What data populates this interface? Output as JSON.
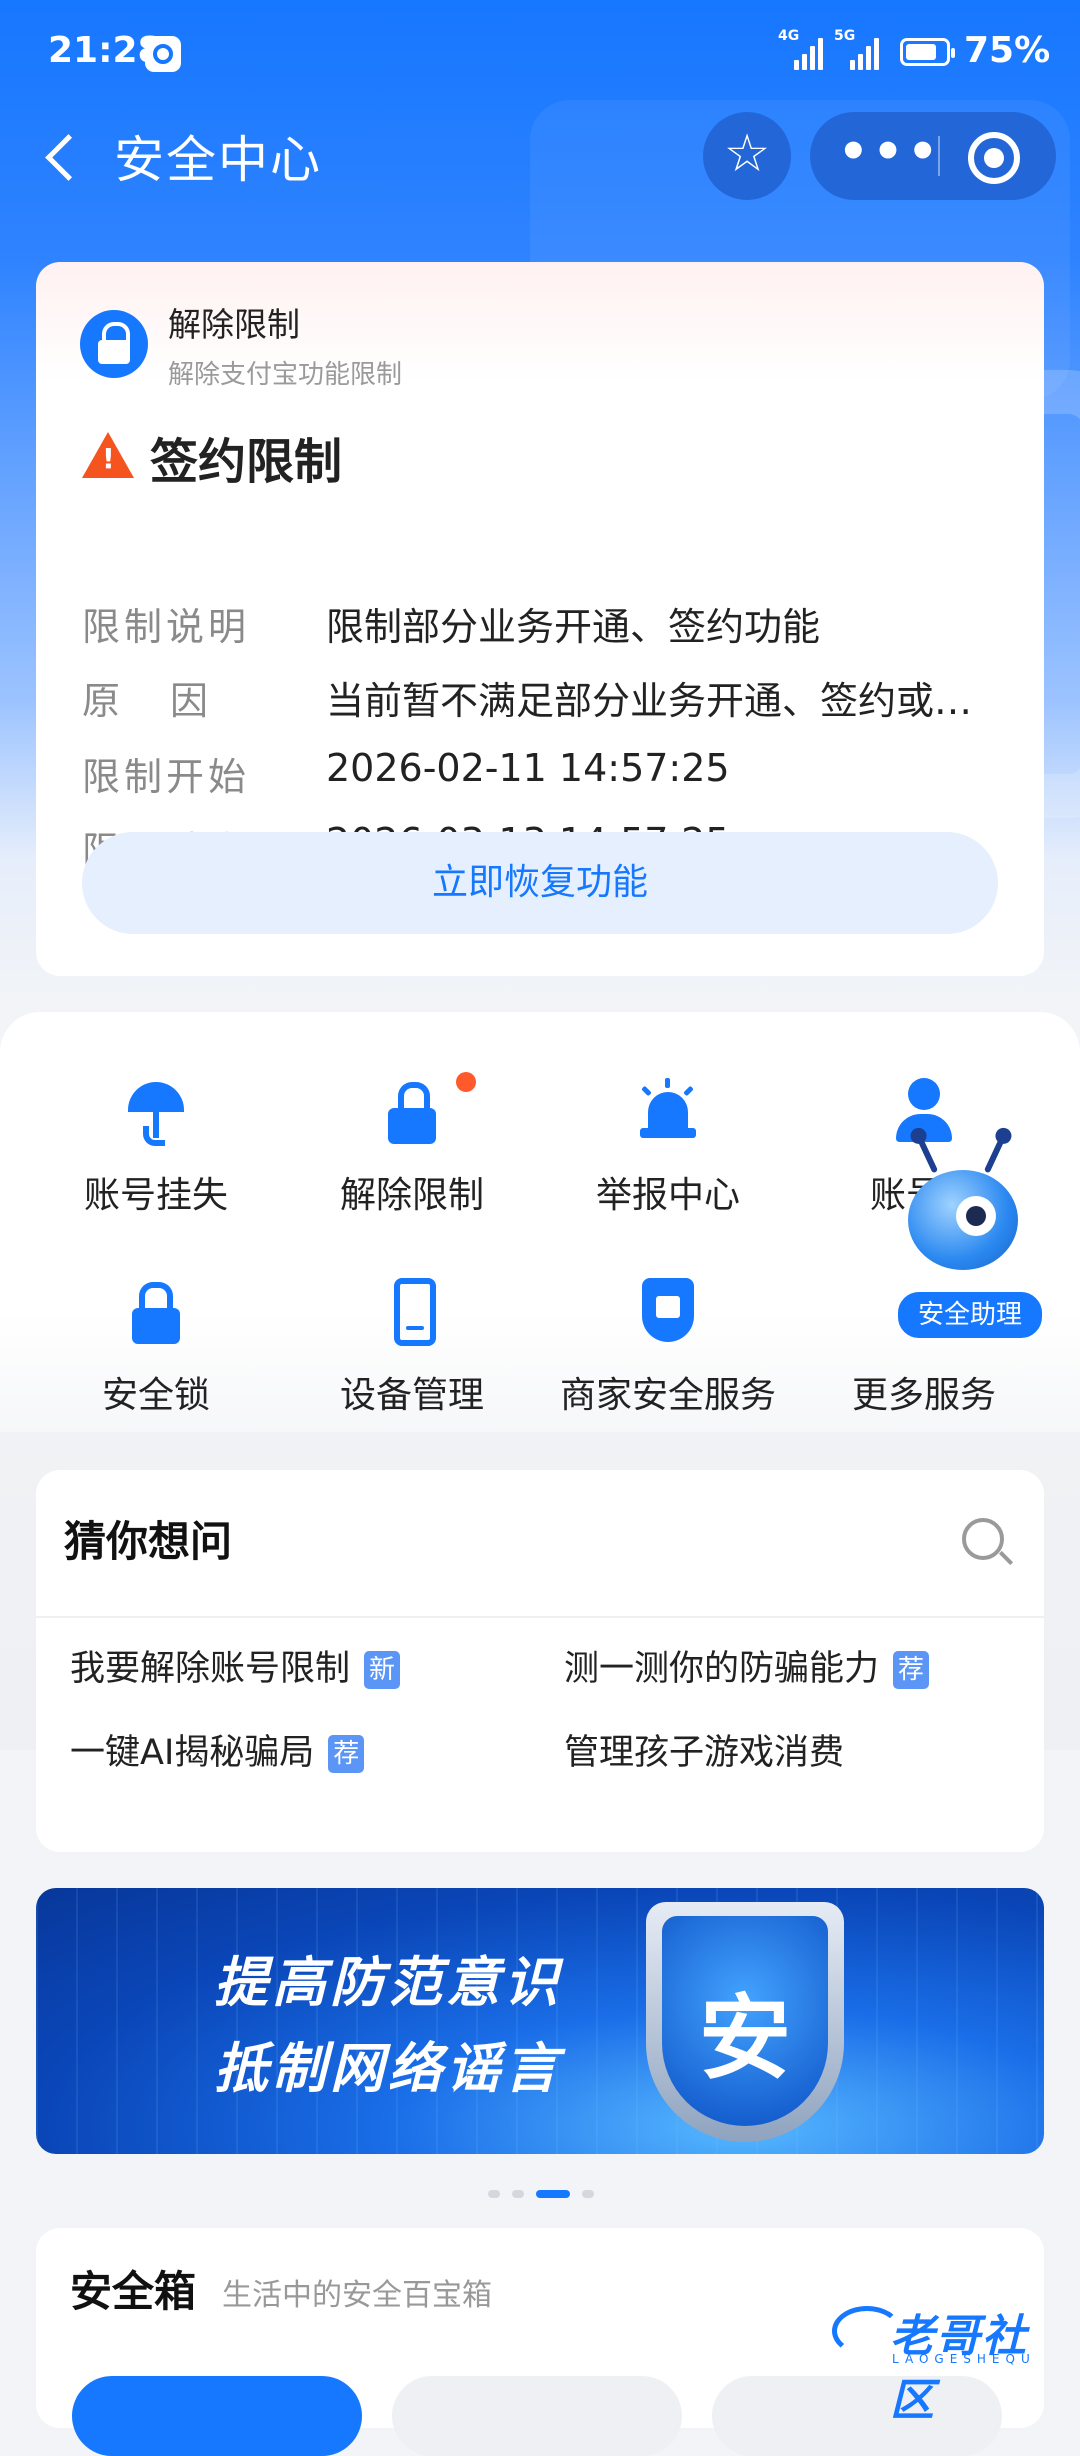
{
  "status_bar": {
    "time": "21:28",
    "network1": "4G",
    "network2": "5G",
    "battery_percent": "75%",
    "battery_level": 0.75
  },
  "nav": {
    "title": "安全中心",
    "favorite_icon": "star-icon",
    "more_icon": "more-dots-icon",
    "close_icon": "target-icon"
  },
  "restriction_card": {
    "header_title": "解除限制",
    "header_subtitle": "解除支付宝功能限制",
    "section_title": "签约限制",
    "rows": [
      {
        "key": "限制说明",
        "value": "限制部分业务开通、签约功能"
      },
      {
        "key": "原因",
        "value": "当前暂不满足部分业务开通、签约或…"
      },
      {
        "key": "限制开始",
        "value": "2026-02-11 14:57:25"
      },
      {
        "key": "限制结束",
        "value": "2026-03-13 14:57:25"
      }
    ],
    "restore_button": "立即恢复功能"
  },
  "services": {
    "items": [
      {
        "label": "账号挂失",
        "icon": "umbrella-icon"
      },
      {
        "label": "解除限制",
        "icon": "unlock-icon"
      },
      {
        "label": "举报中心",
        "icon": "alarm-icon"
      },
      {
        "label": "账号…",
        "icon": "person-icon"
      },
      {
        "label": "安全锁",
        "icon": "lock-icon"
      },
      {
        "label": "设备管理",
        "icon": "phone-icon"
      },
      {
        "label": "商家安全服务",
        "icon": "shield-store-icon"
      },
      {
        "label": "更多服务",
        "icon": "more-services-icon"
      }
    ],
    "assistant_label": "安全助理"
  },
  "guess": {
    "title": "猜你想问",
    "questions": [
      {
        "text": "我要解除账号限制",
        "tag": "新"
      },
      {
        "text": "测一测你的防骗能力",
        "tag": "荐"
      },
      {
        "text": "一键AI揭秘骗局",
        "tag": "荐"
      },
      {
        "text": "管理孩子游戏消费",
        "tag": ""
      }
    ]
  },
  "banner": {
    "line1": "提高防范意识",
    "line2": "抵制网络谣言",
    "shield_char": "安",
    "active_page": 3,
    "page_count": 4
  },
  "safe_box": {
    "title": "安全箱",
    "subtitle": "生活中的安全百宝箱"
  },
  "watermark": {
    "text": "老哥社区",
    "sub": "LAOGESHEQU"
  },
  "colors": {
    "brand": "#1677ff",
    "warning": "#f5541f",
    "badge": "#ff5a2c"
  }
}
